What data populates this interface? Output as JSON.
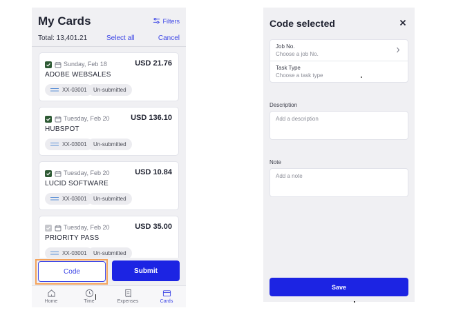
{
  "left": {
    "title": "My Cards",
    "filters_label": "Filters",
    "total": "Total: 13,401.21",
    "select_all": "Select all",
    "cancel": "Cancel",
    "cards": [
      {
        "checked": true,
        "date": "Sunday, Feb 18",
        "amount": "USD 21.76",
        "merchant": "ADOBE WEBSALES",
        "code": "XX-03001",
        "status": "Un-submitted"
      },
      {
        "checked": true,
        "date": "Tuesday, Feb 20",
        "amount": "USD 136.10",
        "merchant": "HUBSPOT",
        "code": "XX-03001",
        "status": "Un-submitted"
      },
      {
        "checked": true,
        "date": "Tuesday, Feb 20",
        "amount": "USD 10.84",
        "merchant": "LUCID SOFTWARE",
        "code": "XX-03001",
        "status": "Un-submitted"
      },
      {
        "checked": false,
        "date": "Tuesday, Feb 20",
        "amount": "USD 35.00",
        "merchant": "PRIORITY PASS",
        "code": "XX-03001",
        "status": "Un-submitted"
      }
    ],
    "code_button": "Code",
    "submit_button": "Submit",
    "tabs": [
      {
        "label": "Home",
        "icon": "home-icon"
      },
      {
        "label": "Time",
        "icon": "clock-icon"
      },
      {
        "label": "Expenses",
        "icon": "receipt-icon"
      },
      {
        "label": "Cards",
        "icon": "card-icon",
        "active": true
      }
    ]
  },
  "right": {
    "title": "Code selected",
    "job_label": "Job No.",
    "job_placeholder": "Choose a job No.",
    "task_label": "Task Type",
    "task_placeholder": "Choose a task type",
    "description_label": "Description",
    "description_placeholder": "Add a description",
    "note_label": "Note",
    "note_placeholder": "Add a note",
    "save_button": "Save"
  },
  "colors": {
    "accent": "#1c24e3",
    "link": "#3d46e6",
    "checkbox": "#2e5a34",
    "highlight": "#f4a35c",
    "background": "#f0f0f3"
  }
}
